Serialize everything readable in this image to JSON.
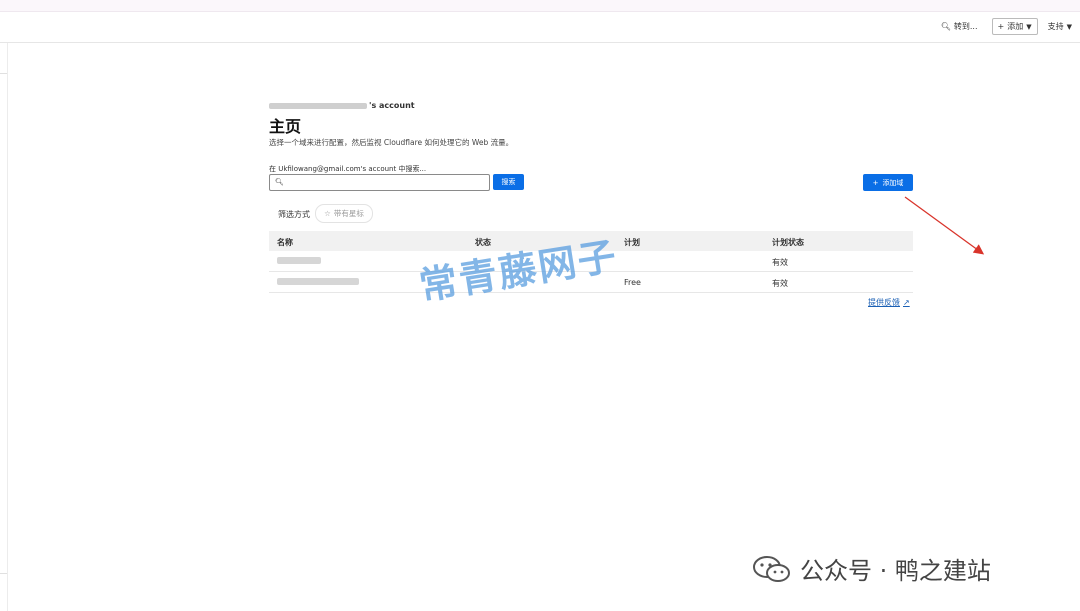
{
  "topbar": {
    "goto_label": "转到...",
    "add_label": "添加",
    "support_label": "支持"
  },
  "account": {
    "suffix": "'s account"
  },
  "page": {
    "title": "主页",
    "description": "选择一个域来进行配置，然后监视 Cloudflare 如何处理它的 Web 流量。",
    "search_label": "在 Ukfilowang@gmail.com's account 中搜索...",
    "search_value": "",
    "search_button": "搜索",
    "add_domain_button": "添加域"
  },
  "filter": {
    "label": "筛选方式",
    "starred_chip": "带有星标"
  },
  "table": {
    "headers": [
      "名称",
      "状态",
      "计划",
      "计划状态"
    ],
    "rows": [
      {
        "name": "",
        "status": "",
        "plan": "",
        "plan_status": "有效"
      },
      {
        "name": "",
        "status": "",
        "plan": "Free",
        "plan_status": "有效"
      }
    ]
  },
  "feedback_link": "提供反馈",
  "watermark": "常青藤网子",
  "footer": {
    "wechat_text": "公众号 · 鸭之建站"
  },
  "colors": {
    "primary": "#0a6ee6",
    "link": "#1a5fb4",
    "annotation_arrow": "#d9342b",
    "watermark": "#5a9ee0"
  },
  "icons": [
    "search-icon",
    "plus-icon",
    "caret-down-icon",
    "star-icon",
    "external-link-icon",
    "wechat-icon"
  ]
}
